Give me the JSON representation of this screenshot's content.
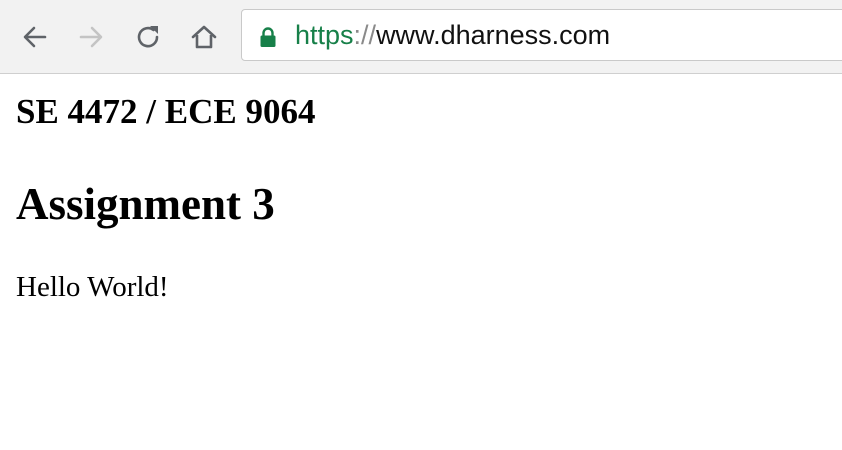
{
  "browser": {
    "nav": {
      "back_icon": "arrow-left-icon",
      "forward_icon": "arrow-right-icon",
      "reload_icon": "reload-icon",
      "home_icon": "home-icon"
    },
    "address_bar": {
      "lock_icon": "lock-icon",
      "scheme": "https",
      "separator": "://",
      "host": "www.dharness.com",
      "scheme_color": "#178049"
    }
  },
  "page": {
    "course": "SE 4472 / ECE 9064",
    "title": "Assignment 3",
    "body_text": "Hello World!"
  }
}
